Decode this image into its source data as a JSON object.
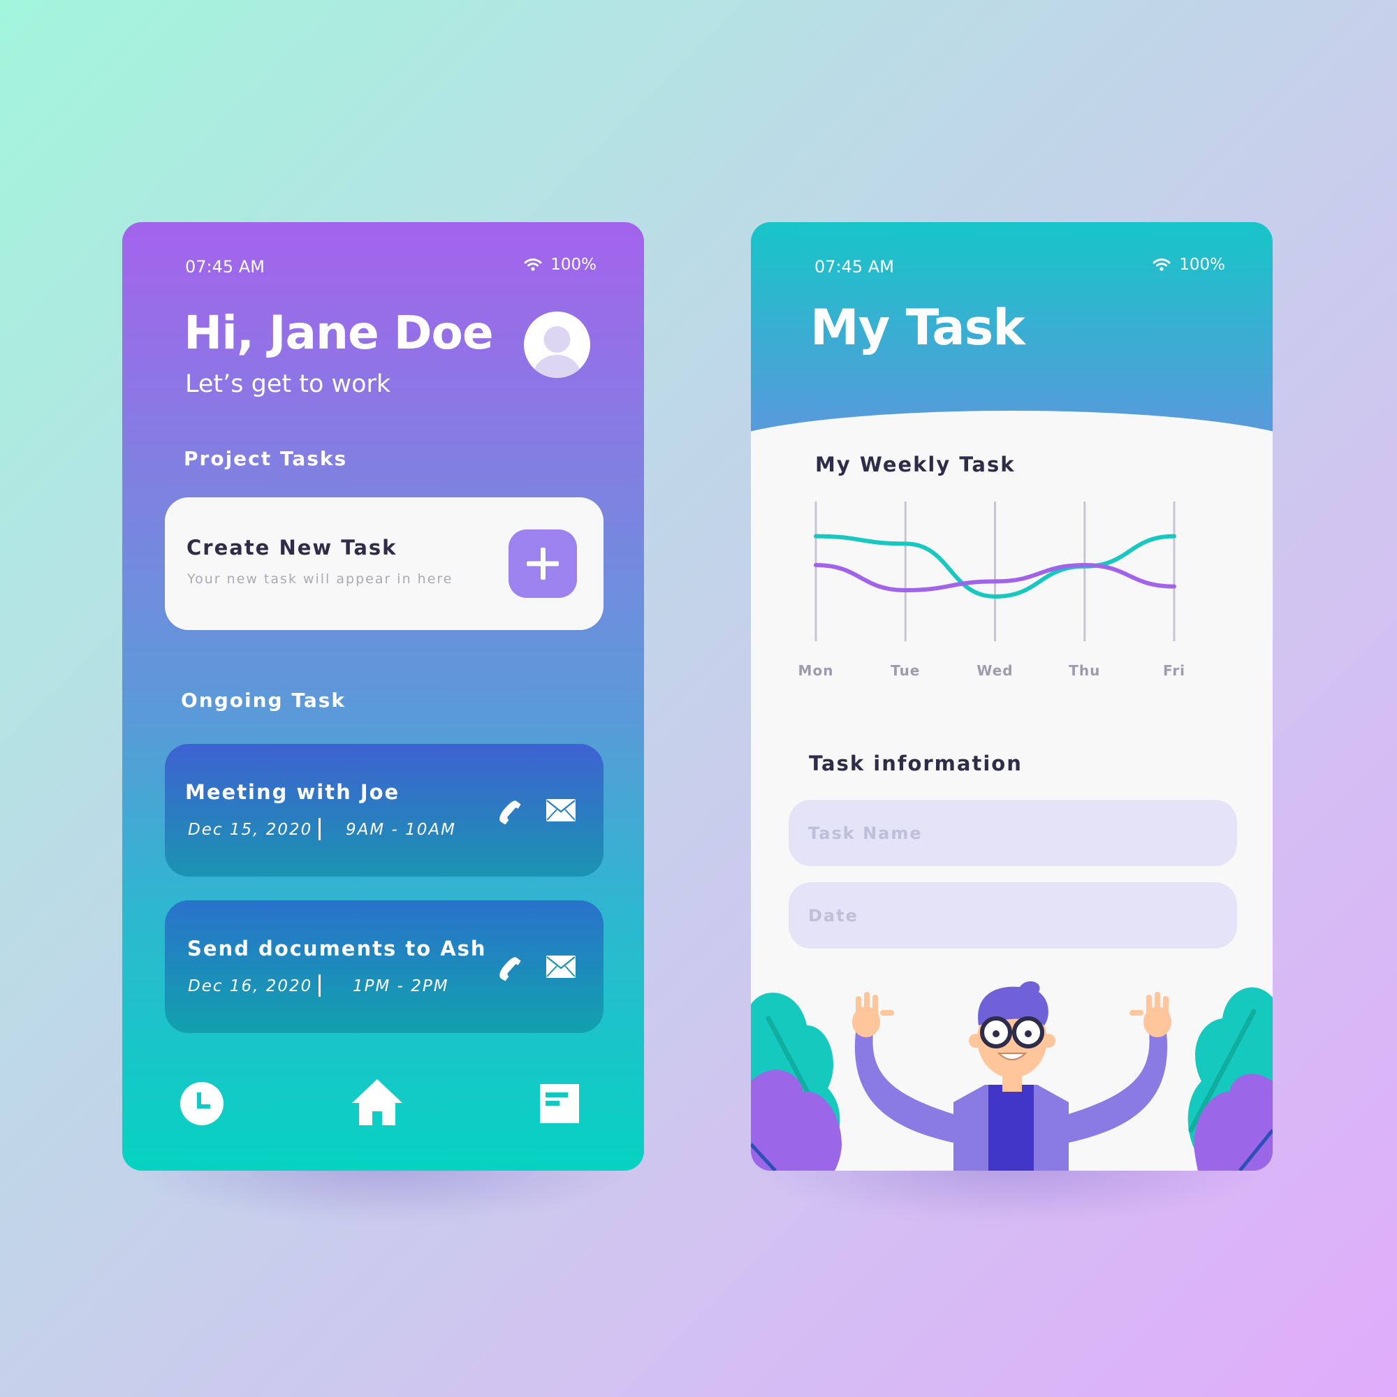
{
  "left_screen": {
    "status": {
      "time": "07:45 AM",
      "battery": "100%"
    },
    "greeting": "Hi, Jane Doe",
    "subtitle": "Let’s get to work",
    "project_section": "Project Tasks",
    "create_card": {
      "title": "Create New Task",
      "subtitle": "Your new task will appear in here",
      "add_icon": "plus-icon"
    },
    "ongoing_section": "Ongoing Task",
    "tasks": [
      {
        "title": "Meeting with Joe",
        "date": "Dec 15, 2020",
        "time": "9AM - 10AM"
      },
      {
        "title": "Send documents to Ash",
        "date": "Dec 16, 2020",
        "time": "1PM - 2PM"
      }
    ],
    "nav": [
      "clock-icon",
      "home-icon",
      "notes-icon"
    ]
  },
  "right_screen": {
    "status": {
      "time": "07:45 AM",
      "battery": "100%"
    },
    "title": "My Task",
    "weekly_section": "My Weekly Task",
    "info_section": "Task information",
    "fields": {
      "task_name_placeholder": "Task Name",
      "date_placeholder": "Date"
    }
  },
  "chart_data": {
    "type": "line",
    "title": "My Weekly Task",
    "categories": [
      "Mon",
      "Tue",
      "Wed",
      "Thu",
      "Fri"
    ],
    "series": [
      {
        "values": [
          0.78,
          0.72,
          0.3,
          0.54,
          0.78
        ],
        "color": "#16c8c0"
      },
      {
        "values": [
          0.55,
          0.35,
          0.42,
          0.55,
          0.38
        ],
        "color": "#a063ea"
      }
    ],
    "ylim": [
      0,
      1
    ],
    "grid": "vertical"
  },
  "colors": {
    "purple": "#a463ec",
    "teal": "#06d3c2",
    "accent": "#9b82ef",
    "dark_text": "#2e2c48"
  }
}
